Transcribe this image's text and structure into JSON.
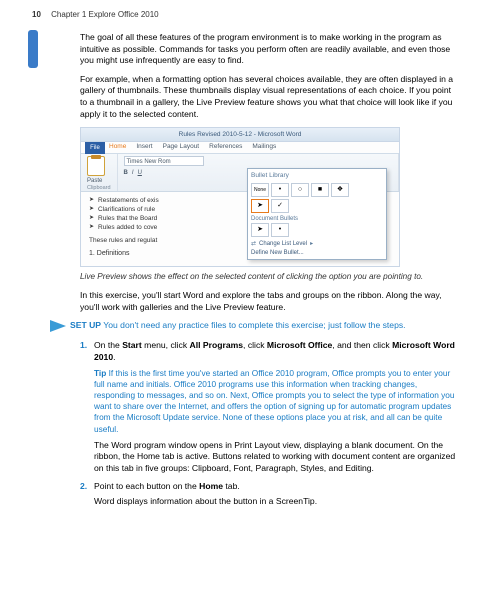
{
  "header": {
    "page": "10",
    "chapter": "Chapter 1   Explore Office 2010"
  },
  "paras": {
    "p1": "The goal of all these features of the program environment is to make working in the program as intuitive as possible. Commands for tasks you perform often are readily available, and even those you might use infrequently are easy to find.",
    "p2": "For example, when a formatting option has several choices available, they are often displayed in a gallery of thumbnails. These thumbnails display visual representations of each choice. If you point to a thumbnail in a gallery, the Live Preview feature shows you what that choice will look like if you apply it to the selected content."
  },
  "screenshot": {
    "title": "Rules Revised 2010-5-12 - Microsoft Word",
    "file_tab": "File",
    "tabs": [
      "Home",
      "Insert",
      "Page Layout",
      "References",
      "Mailings"
    ],
    "paste_label": "Paste",
    "clipboard_label": "Clipboard",
    "font_name": "Times New Rom",
    "doc_lines": [
      "Restatements of exis",
      "Clarifications of rule",
      "Rules that the Board",
      "Rules added to cove"
    ],
    "doc_tail": "These rules and regulat",
    "doc_heading": "1. Definitions",
    "bullet_popup": {
      "title": "Bullet Library",
      "none_label": "None",
      "doc_label": "Document Bullets",
      "change": "Change List Level",
      "define": "Define New Bullet..."
    }
  },
  "caption": "Live Preview shows the effect on the selected content of clicking the option you are pointing to.",
  "exercise_intro": "In this exercise, you'll start Word and explore the tabs and groups on the ribbon. Along the way, you'll work with galleries and the Live Preview feature.",
  "setup": {
    "label": "SET UP",
    "body": "You don't need any practice files to complete this exercise; just follow the steps."
  },
  "steps": [
    {
      "pre": "On the ",
      "b1": "Start",
      "mid1": " menu, click ",
      "b2": "All Programs",
      "mid2": ", click ",
      "b3": "Microsoft Office",
      "mid3": ", and then click ",
      "b4": "Microsoft Word 2010",
      "post": ".",
      "tip_label": "Tip",
      "tip": "If this is the first time you've started an Office 2010 program, Office prompts you to enter your full name and initials. Office 2010 programs use this information when tracking changes, responding to messages, and so on. Next, Office prompts you to select the type of information you want to share over the Internet, and offers the option of signing up for automatic program updates from the Microsoft Update service. None of these options place you at risk, and all can be quite useful.",
      "after": "The Word program window opens in Print Layout view, displaying a blank document. On the ribbon, the Home tab is active. Buttons related to working with document content are organized on this tab in five groups: Clipboard, Font, Paragraph, Styles, and Editing."
    },
    {
      "pre": "Point to each button on the ",
      "b1": "Home",
      "post": " tab.",
      "after": "Word displays information about the button in a ScreenTip."
    }
  ]
}
